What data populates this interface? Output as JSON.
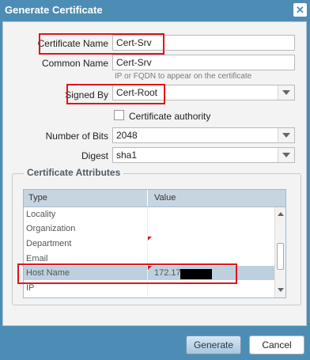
{
  "dialog": {
    "title": "Generate Certificate",
    "close_glyph": "✕"
  },
  "form": {
    "certificate_name": {
      "label": "Certificate Name",
      "value": "Cert-Srv"
    },
    "common_name": {
      "label": "Common Name",
      "value": "Cert-Srv",
      "hint": "IP or FQDN to appear on the certificate"
    },
    "signed_by": {
      "label": "Signed By",
      "value": "Cert-Root"
    },
    "certificate_authority": {
      "label": "Certificate authority",
      "checked": false
    },
    "number_of_bits": {
      "label": "Number of Bits",
      "value": "2048"
    },
    "digest": {
      "label": "Digest",
      "value": "sha1"
    }
  },
  "attributes": {
    "legend": "Certificate Attributes",
    "columns": [
      "Type",
      "Value"
    ],
    "rows": [
      {
        "type": "Locality",
        "value": ""
      },
      {
        "type": "Organization",
        "value": ""
      },
      {
        "type": "Department",
        "value": ""
      },
      {
        "type": "Email",
        "value": ""
      },
      {
        "type": "Host Name",
        "value": "172.17"
      },
      {
        "type": "IP",
        "value": ""
      }
    ]
  },
  "footer": {
    "generate_label": "Generate",
    "cancel_label": "Cancel"
  },
  "colors": {
    "frame": "#4d8db5",
    "highlight_box": "#e0141b",
    "selected_row": "#bdd0de"
  }
}
